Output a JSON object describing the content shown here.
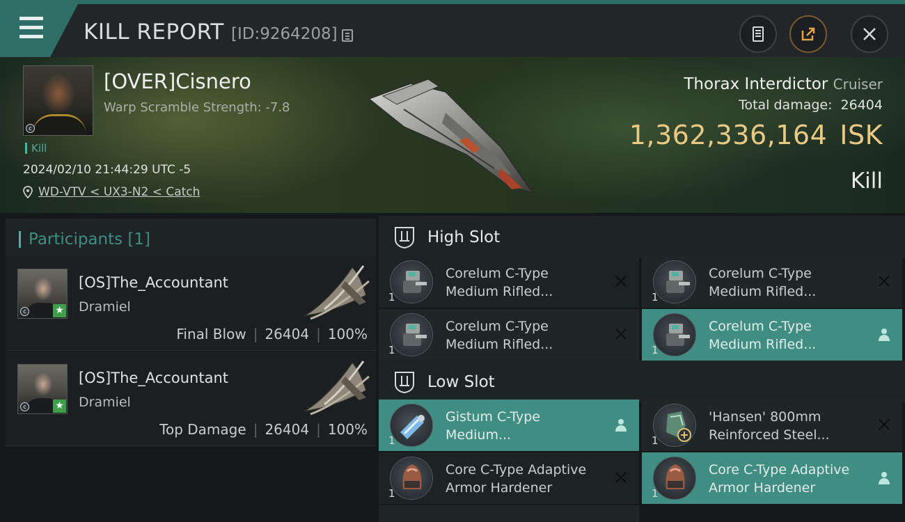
{
  "header": {
    "title": "KILL REPORT",
    "report_id": "[ID:9264208]",
    "icons": [
      "menu-icon",
      "copy-icon",
      "clipboard-icon",
      "share-icon",
      "close-icon"
    ]
  },
  "victim": {
    "name": "[OVER]Cisnero",
    "warp_scramble": "Warp Scramble Strength: -7.8",
    "tag": "Kill",
    "timestamp": "2024/02/10 21:44:29 UTC -5",
    "location": "WD-VTV < UX3-N2 < Catch",
    "ship_name": "Thorax Interdictor",
    "ship_class": "Cruiser",
    "damage_label": "Total damage:",
    "damage_value": "26404",
    "isk_value": "1,362,336,164",
    "isk_unit": "ISK",
    "result": "Kill"
  },
  "participants": {
    "title": "Participants",
    "count": "[1]",
    "rows": [
      {
        "name": "[OS]The_Accountant",
        "corp": "Dramiel",
        "role": "Final Blow",
        "damage": "26404",
        "percent": "100%"
      },
      {
        "name": "[OS]The_Accountant",
        "corp": "Dramiel",
        "role": "Top Damage",
        "damage": "26404",
        "percent": "100%"
      }
    ]
  },
  "slots": {
    "high": {
      "title": "High Slot",
      "modules": [
        {
          "name": "Corelum C-Type\nMedium Rifled...",
          "qty": "1",
          "status": "destroyed"
        },
        {
          "name": "Corelum C-Type\nMedium Rifled...",
          "qty": "1",
          "status": "destroyed"
        },
        {
          "name": "Corelum C-Type\nMedium Rifled...",
          "qty": "1",
          "status": "destroyed"
        },
        {
          "name": "Corelum C-Type\nMedium Rifled...",
          "qty": "1",
          "status": "dropped"
        }
      ]
    },
    "low": {
      "title": "Low Slot",
      "modules": [
        {
          "name": "Gistum C-Type\nMedium...",
          "qty": "1",
          "status": "dropped"
        },
        {
          "name": "'Hansen' 800mm\nReinforced Steel...",
          "qty": "1",
          "status": "destroyed"
        },
        {
          "name": "Core C-Type Adaptive\n Armor Hardener",
          "qty": "1",
          "status": "destroyed"
        },
        {
          "name": "Core C-Type Adaptive\n Armor Hardener",
          "qty": "1",
          "status": "dropped"
        }
      ]
    }
  },
  "colors": {
    "accent": "#3f8d83",
    "isk": "#e9c983",
    "panel": "#1d2225"
  }
}
